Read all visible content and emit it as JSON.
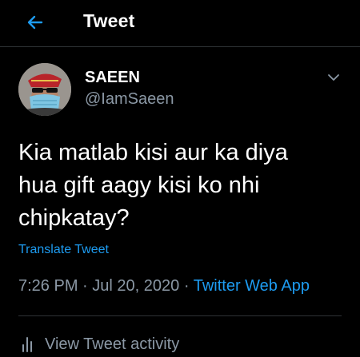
{
  "colors": {
    "background": "#000000",
    "text": "#ffffff",
    "secondary_text": "#8b98a5",
    "accent": "#1d9bf0",
    "divider": "#2f3336"
  },
  "header": {
    "back_icon": "back-arrow-icon",
    "title": "Tweet"
  },
  "tweet": {
    "author": {
      "display_name": "SAEEN",
      "handle": "@IamSaeen",
      "avatar_icon": "avatar"
    },
    "menu_icon": "chevron-down-icon",
    "text": "Kia matlab kisi aur ka diya\nhua gift aagy kisi ko nhi\nchipkatay?",
    "translate_label": "Translate Tweet",
    "time": "7:26 PM",
    "date": "Jul 20, 2020",
    "separator": "·",
    "source": "Twitter Web App"
  },
  "activity": {
    "icon": "bar-chart-icon",
    "label": "View Tweet activity"
  }
}
